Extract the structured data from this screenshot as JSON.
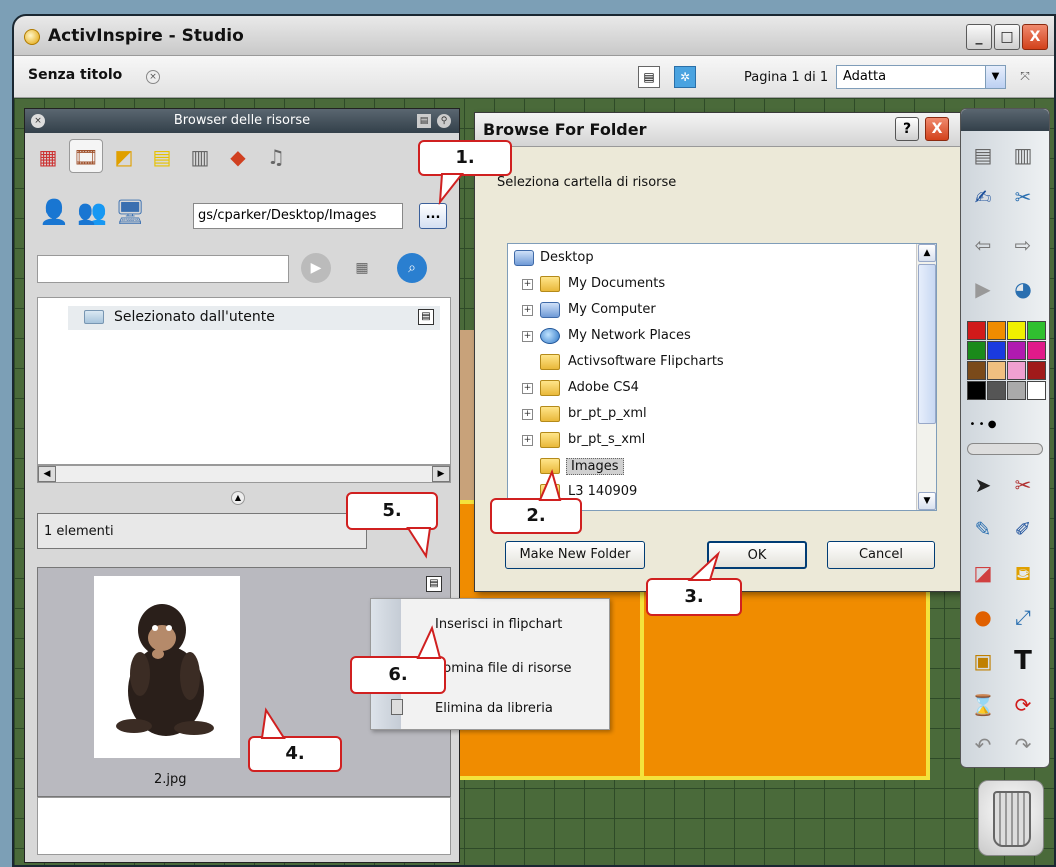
{
  "window": {
    "title": "ActivInspire - Studio",
    "minimize": "_",
    "maximize": "□",
    "close": "X"
  },
  "tabbar": {
    "doc_title": "Senza titolo",
    "page_label": "Pagina 1 di 1",
    "zoom_value": "Adatta"
  },
  "resource_browser": {
    "title": "Browser delle risorse",
    "path_value": "gs/cparker/Desktop/Images",
    "browse_label": "...",
    "tree_item": "Selezionato dall'utente",
    "item_count": "1 elementi",
    "thumbnail_name": "2.jpg"
  },
  "context_menu": {
    "items": [
      "Inserisci in flipchart",
      "nomina file di risorse",
      "Elimina da libreria"
    ]
  },
  "dialog": {
    "title": "Browse For Folder",
    "message": "Seleziona cartella di risorse",
    "help": "?",
    "close": "X",
    "tree": [
      {
        "label": "Desktop",
        "icon": "desktop-icon",
        "expander": false
      },
      {
        "label": "My Documents",
        "icon": "my-documents-icon",
        "expander": true
      },
      {
        "label": "My Computer",
        "icon": "my-computer-icon",
        "expander": true
      },
      {
        "label": "My Network Places",
        "icon": "network-icon",
        "expander": true
      },
      {
        "label": "Activsoftware Flipcharts",
        "icon": "folder-icon",
        "expander": false
      },
      {
        "label": "Adobe CS4",
        "icon": "folder-icon",
        "expander": true
      },
      {
        "label": "br_pt_p_xml",
        "icon": "folder-icon",
        "expander": true
      },
      {
        "label": "br_pt_s_xml",
        "icon": "folder-icon",
        "expander": true
      },
      {
        "label": "Images",
        "icon": "folder-open-icon",
        "expander": false,
        "selected": true
      },
      {
        "label": "L3 140909",
        "icon": "folder-icon",
        "expander": false
      }
    ],
    "make_new_folder": "Make New Folder",
    "ok": "OK",
    "cancel": "Cancel"
  },
  "callouts": {
    "c1": "1.",
    "c2": "2.",
    "c3": "3.",
    "c4": "4.",
    "c5": "5.",
    "c6": "6."
  },
  "colors": {
    "accent_callout": "#d02020",
    "canvas_orange": "#f08c00",
    "dialog_bg": "#ece9d8"
  }
}
